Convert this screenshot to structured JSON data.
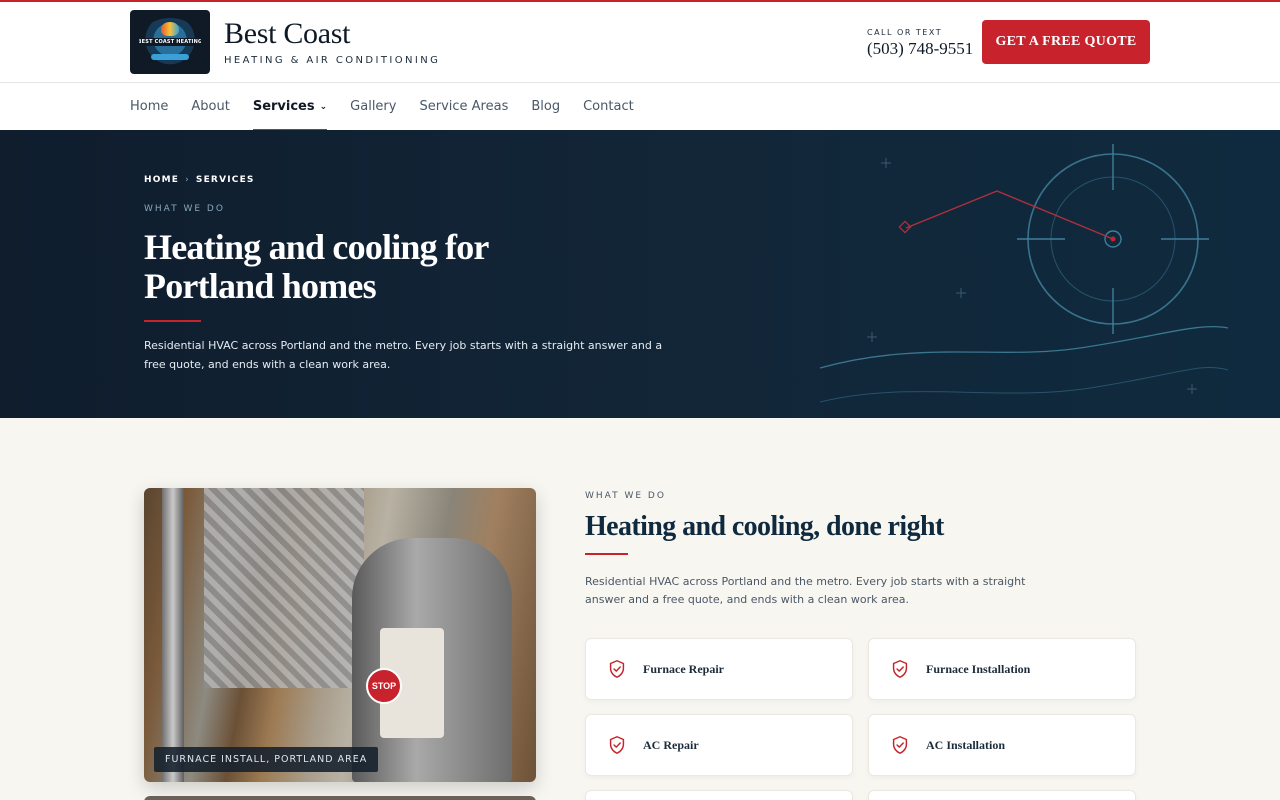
{
  "header": {
    "logo_text": "BEST COAST HEATING",
    "brand_name": "Best Coast",
    "brand_tagline": "HEATING & AIR CONDITIONING",
    "call_label": "CALL OR TEXT",
    "phone": "(503) 748-9551",
    "quote_button": "GET A FREE QUOTE"
  },
  "nav": {
    "items": [
      {
        "label": "Home"
      },
      {
        "label": "About"
      },
      {
        "label": "Services",
        "active": true
      },
      {
        "label": "Gallery"
      },
      {
        "label": "Service Areas"
      },
      {
        "label": "Blog"
      },
      {
        "label": "Contact"
      }
    ]
  },
  "hero": {
    "breadcrumb": [
      "HOME",
      "SERVICES"
    ],
    "breadcrumb_separator": "›",
    "eyebrow": "WHAT WE DO",
    "title": "Heating and cooling for Portland homes",
    "text": "Residential HVAC across Portland and the metro. Every job starts with a straight answer and a free quote, and ends with a clean work area."
  },
  "section": {
    "photo_caption": "FURNACE INSTALL, PORTLAND AREA",
    "eyebrow": "WHAT WE DO",
    "title": "Heating and cooling, done right",
    "text": "Residential HVAC across Portland and the metro. Every job starts with a straight answer and a free quote, and ends with a clean work area.",
    "services": [
      {
        "label": "Furnace Repair",
        "icon": "shield-check-icon"
      },
      {
        "label": "Furnace Installation",
        "icon": "shield-check-icon"
      },
      {
        "label": "AC Repair",
        "icon": "shield-check-icon"
      },
      {
        "label": "AC Installation",
        "icon": "shield-check-icon"
      }
    ]
  },
  "colors": {
    "accent": "#c8232c",
    "hero_bg": "#122638",
    "page_bg": "#f8f6f1",
    "navy": "#0f2a3e"
  }
}
